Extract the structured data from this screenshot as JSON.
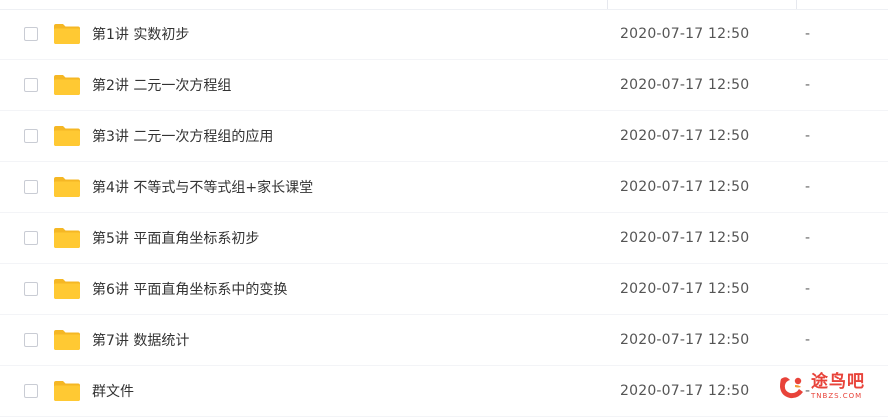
{
  "files": [
    {
      "name": "第1讲 实数初步",
      "date": "2020-07-17 12:50",
      "size": "-"
    },
    {
      "name": "第2讲 二元一次方程组",
      "date": "2020-07-17 12:50",
      "size": "-"
    },
    {
      "name": "第3讲 二元一次方程组的应用",
      "date": "2020-07-17 12:50",
      "size": "-"
    },
    {
      "name": "第4讲 不等式与不等式组+家长课堂",
      "date": "2020-07-17 12:50",
      "size": "-"
    },
    {
      "name": "第5讲 平面直角坐标系初步",
      "date": "2020-07-17 12:50",
      "size": "-"
    },
    {
      "name": "第6讲 平面直角坐标系中的变换",
      "date": "2020-07-17 12:50",
      "size": "-"
    },
    {
      "name": "第7讲 数据统计",
      "date": "2020-07-17 12:50",
      "size": "-"
    },
    {
      "name": "群文件",
      "date": "2020-07-17 12:50",
      "size": "-"
    }
  ],
  "icons": {
    "row_icon": "folder-icon",
    "watermark_logo": "tubaba-logo-icon"
  },
  "colors": {
    "folder": "#ffc933",
    "folder_back": "#f5b724",
    "watermark": "#e8433a"
  },
  "watermark": {
    "title": "途鸟吧",
    "subtitle": "TNBZS.COM"
  }
}
